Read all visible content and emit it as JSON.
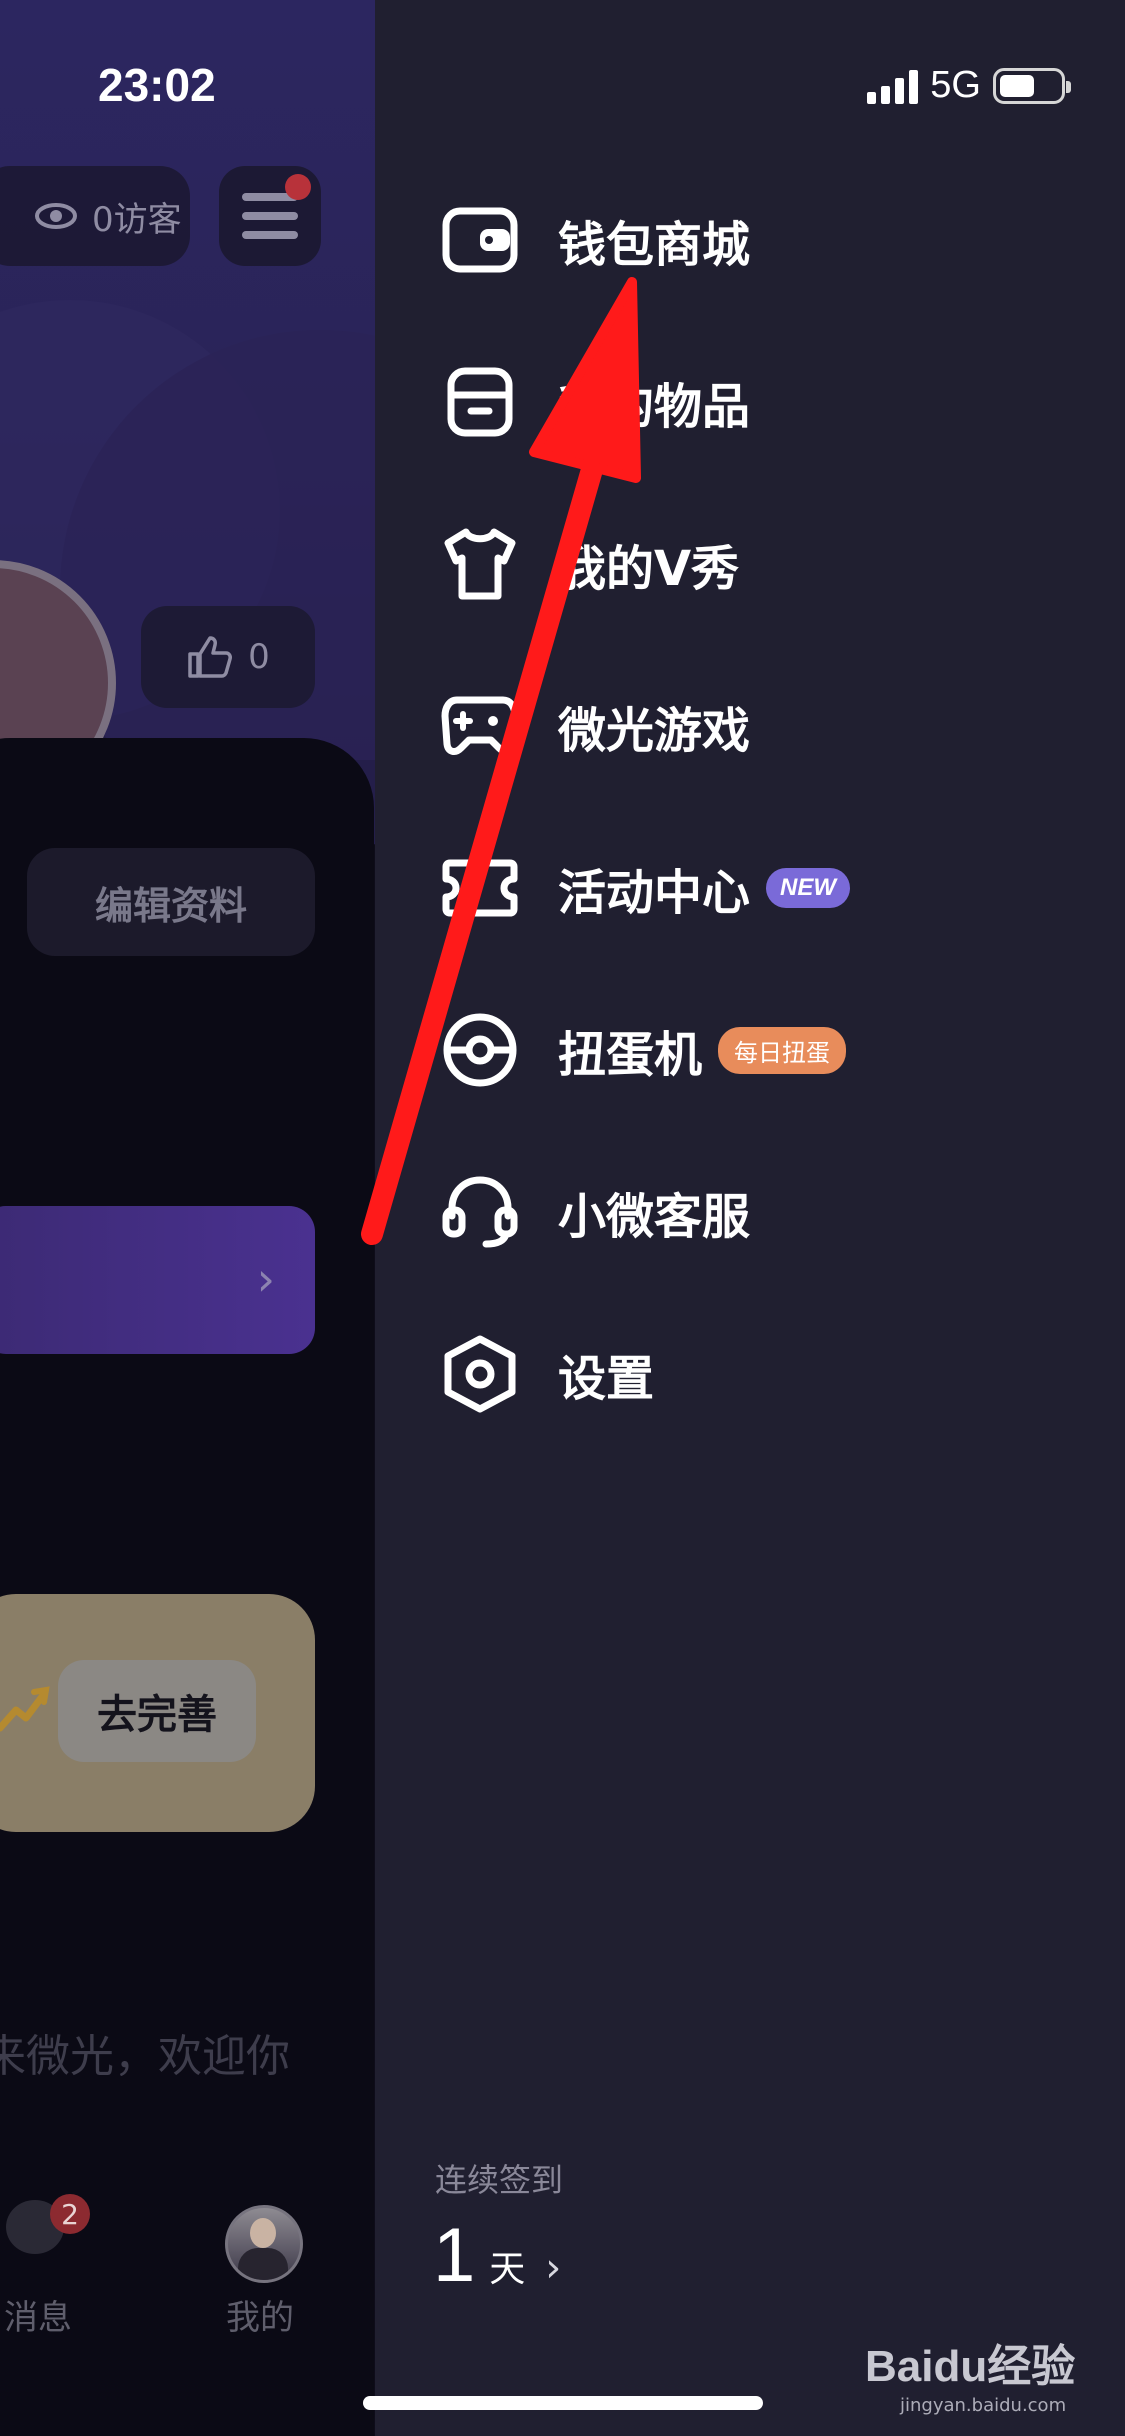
{
  "status_bar": {
    "time": "23:02",
    "network": "5G"
  },
  "profile_page": {
    "visitors_label": "0访客",
    "likes_count": "0",
    "edit_profile_label": "编辑资料",
    "complete_button_label": "去完善",
    "welcome_text": "来微光，欢迎你",
    "tabs": [
      {
        "label": "消息",
        "badge": "2"
      },
      {
        "label": "我的"
      }
    ]
  },
  "drawer": {
    "menu": [
      {
        "label": "钱包商城",
        "icon": "wallet-icon"
      },
      {
        "label": "我的物品",
        "icon": "archive-box-icon"
      },
      {
        "label": "我的V秀",
        "icon": "tshirt-icon"
      },
      {
        "label": "微光游戏",
        "icon": "gamepad-icon"
      },
      {
        "label": "活动中心",
        "icon": "ticket-icon",
        "tag": "NEW"
      },
      {
        "label": "扭蛋机",
        "icon": "capsule-ball-icon",
        "tag": "每日扭蛋"
      },
      {
        "label": "小微客服",
        "icon": "headset-icon"
      },
      {
        "label": "设置",
        "icon": "hex-gear-icon"
      }
    ],
    "signin": {
      "label": "连续签到",
      "count": "1",
      "unit": "天"
    }
  },
  "watermark": {
    "brand": "Baidu经验",
    "url": "jingyan.baidu.com"
  },
  "colors": {
    "drawer_bg": "#201f30",
    "new_tag": "#7a6ad8",
    "daily_tag": "#e88c5b",
    "annotation_arrow": "#ff1a1a"
  }
}
